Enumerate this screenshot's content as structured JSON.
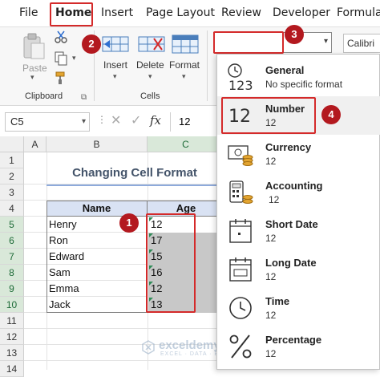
{
  "menu": {
    "tabs": [
      {
        "label": "File"
      },
      {
        "label": "Home"
      },
      {
        "label": "Insert"
      },
      {
        "label": "Page Layout"
      },
      {
        "label": "Review"
      },
      {
        "label": "Developer"
      },
      {
        "label": "Formulas"
      }
    ],
    "active_tab": "Home"
  },
  "ribbon": {
    "clipboard": {
      "paste_label": "Paste",
      "group_label": "Clipboard"
    },
    "cells": {
      "insert_label": "Insert",
      "delete_label": "Delete",
      "format_label": "Format",
      "group_label": "Cells"
    },
    "number_format_value": "",
    "font_name": "Calibri"
  },
  "formula_bar": {
    "name_box": "C5",
    "fx_label": "fx",
    "value": "12"
  },
  "grid": {
    "columns": [
      "A",
      "B",
      "C"
    ],
    "rows": [
      "1",
      "2",
      "3",
      "4",
      "5",
      "6",
      "7",
      "8",
      "9",
      "10",
      "11",
      "12",
      "13",
      "14"
    ],
    "title": "Changing Cell Format",
    "headers": {
      "name": "Name",
      "age": "Age"
    },
    "records": [
      {
        "name": "Henry",
        "age": "12"
      },
      {
        "name": "Ron",
        "age": "17"
      },
      {
        "name": "Edward",
        "age": "15"
      },
      {
        "name": "Sam",
        "age": "16"
      },
      {
        "name": "Emma",
        "age": "12"
      },
      {
        "name": "Jack",
        "age": "13"
      }
    ]
  },
  "format_menu": {
    "items": [
      {
        "name": "General",
        "example": "No specific format",
        "icon": "general-123-icon"
      },
      {
        "name": "Number",
        "example": "12",
        "icon": "number-12-icon"
      },
      {
        "name": "Currency",
        "example": "12",
        "icon": "currency-icon"
      },
      {
        "name": "Accounting",
        "example": "12",
        "icon": "accounting-icon"
      },
      {
        "name": "Short Date",
        "example": "12",
        "icon": "short-date-calendar-icon"
      },
      {
        "name": "Long Date",
        "example": "12",
        "icon": "long-date-calendar-icon"
      },
      {
        "name": "Time",
        "example": "12",
        "icon": "clock-icon"
      },
      {
        "name": "Percentage",
        "example": "12",
        "icon": "percent-icon"
      }
    ]
  },
  "annotations": {
    "step1": "1",
    "step2": "2",
    "step3": "3",
    "step4": "4"
  },
  "watermark": {
    "brand": "exceldemy",
    "tagline": "EXCEL · DATA · BI"
  },
  "colors": {
    "highlight_red": "#d42a2a",
    "badge_red": "#b3191f",
    "selected_cells": "#c8c8c8",
    "title_blue": "#44546a"
  }
}
